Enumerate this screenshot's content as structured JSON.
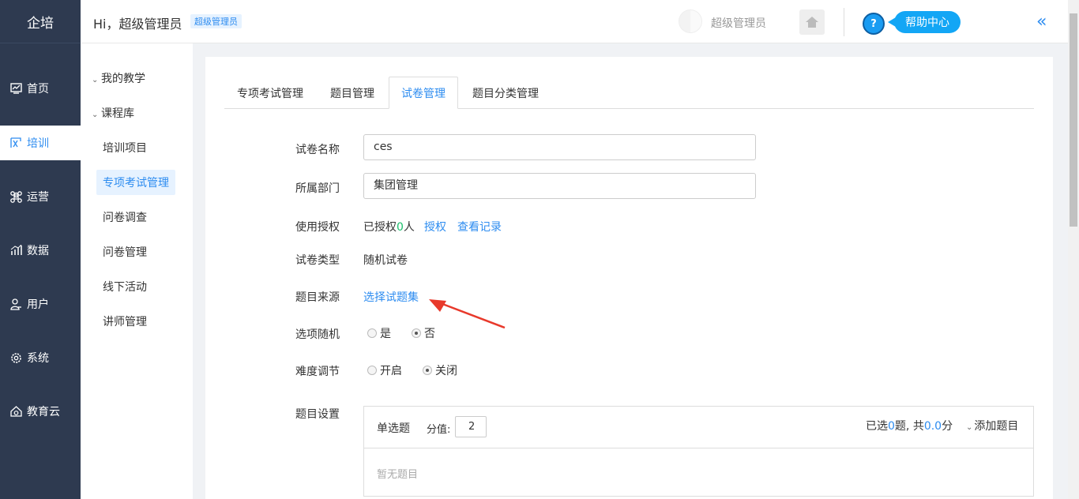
{
  "app": {
    "logo": "企培"
  },
  "leftnav": [
    {
      "label": "首页",
      "icon": "dashboard-icon"
    },
    {
      "label": "培训",
      "icon": "training-icon",
      "active": true
    },
    {
      "label": "运营",
      "icon": "command-icon"
    },
    {
      "label": "数据",
      "icon": "chart-icon"
    },
    {
      "label": "用户",
      "icon": "user-icon"
    },
    {
      "label": "系统",
      "icon": "gear-icon"
    },
    {
      "label": "教育云",
      "icon": "cloud-icon"
    }
  ],
  "header": {
    "greeting": "Hi，超级管理员",
    "role_badge": "超级管理员",
    "user_name": "超级管理员",
    "help_label": "帮助中心",
    "help_q": "?",
    "collapse": "«"
  },
  "subnav": {
    "groups": [
      {
        "label": "我的教学"
      },
      {
        "label": "课程库"
      }
    ],
    "items": [
      {
        "label": "培训项目"
      },
      {
        "label": "专项考试管理",
        "active": true
      },
      {
        "label": "问卷调查"
      },
      {
        "label": "问卷管理"
      },
      {
        "label": "线下活动"
      },
      {
        "label": "讲师管理"
      }
    ]
  },
  "tabs": [
    {
      "label": "专项考试管理"
    },
    {
      "label": "题目管理"
    },
    {
      "label": "试卷管理",
      "active": true
    },
    {
      "label": "题目分类管理"
    }
  ],
  "form": {
    "name_label": "试卷名称",
    "name_value": "ces",
    "dept_label": "所属部门",
    "dept_value": "集团管理",
    "auth_label": "使用授权",
    "auth_prefix": "已授权",
    "auth_count": "0",
    "auth_suffix": "人",
    "auth_link": "授权",
    "record_link": "查看记录",
    "type_label": "试卷类型",
    "type_value": "随机试卷",
    "source_label": "题目来源",
    "source_link": "选择试题集",
    "option_random_label": "选项随机",
    "option_random": {
      "yes": "是",
      "no": "否",
      "selected": "no"
    },
    "difficulty_label": "难度调节",
    "difficulty": {
      "on": "开启",
      "off": "关闭",
      "selected": "off"
    },
    "settings_label": "题目设置"
  },
  "question_box": {
    "type": "单选题",
    "score_label": "分值:",
    "score_value": "2",
    "selected_prefix": "已选",
    "selected_count": "0",
    "selected_mid": "题, 共",
    "total_score": "0.0",
    "total_suffix": "分",
    "add_label": "添加题目",
    "empty_text": "暂无题目"
  },
  "colors": {
    "accent": "#2d8cf0",
    "nav_bg": "#2e3a50",
    "help": "#13a6f5",
    "annotation_arrow": "#e8392b"
  }
}
